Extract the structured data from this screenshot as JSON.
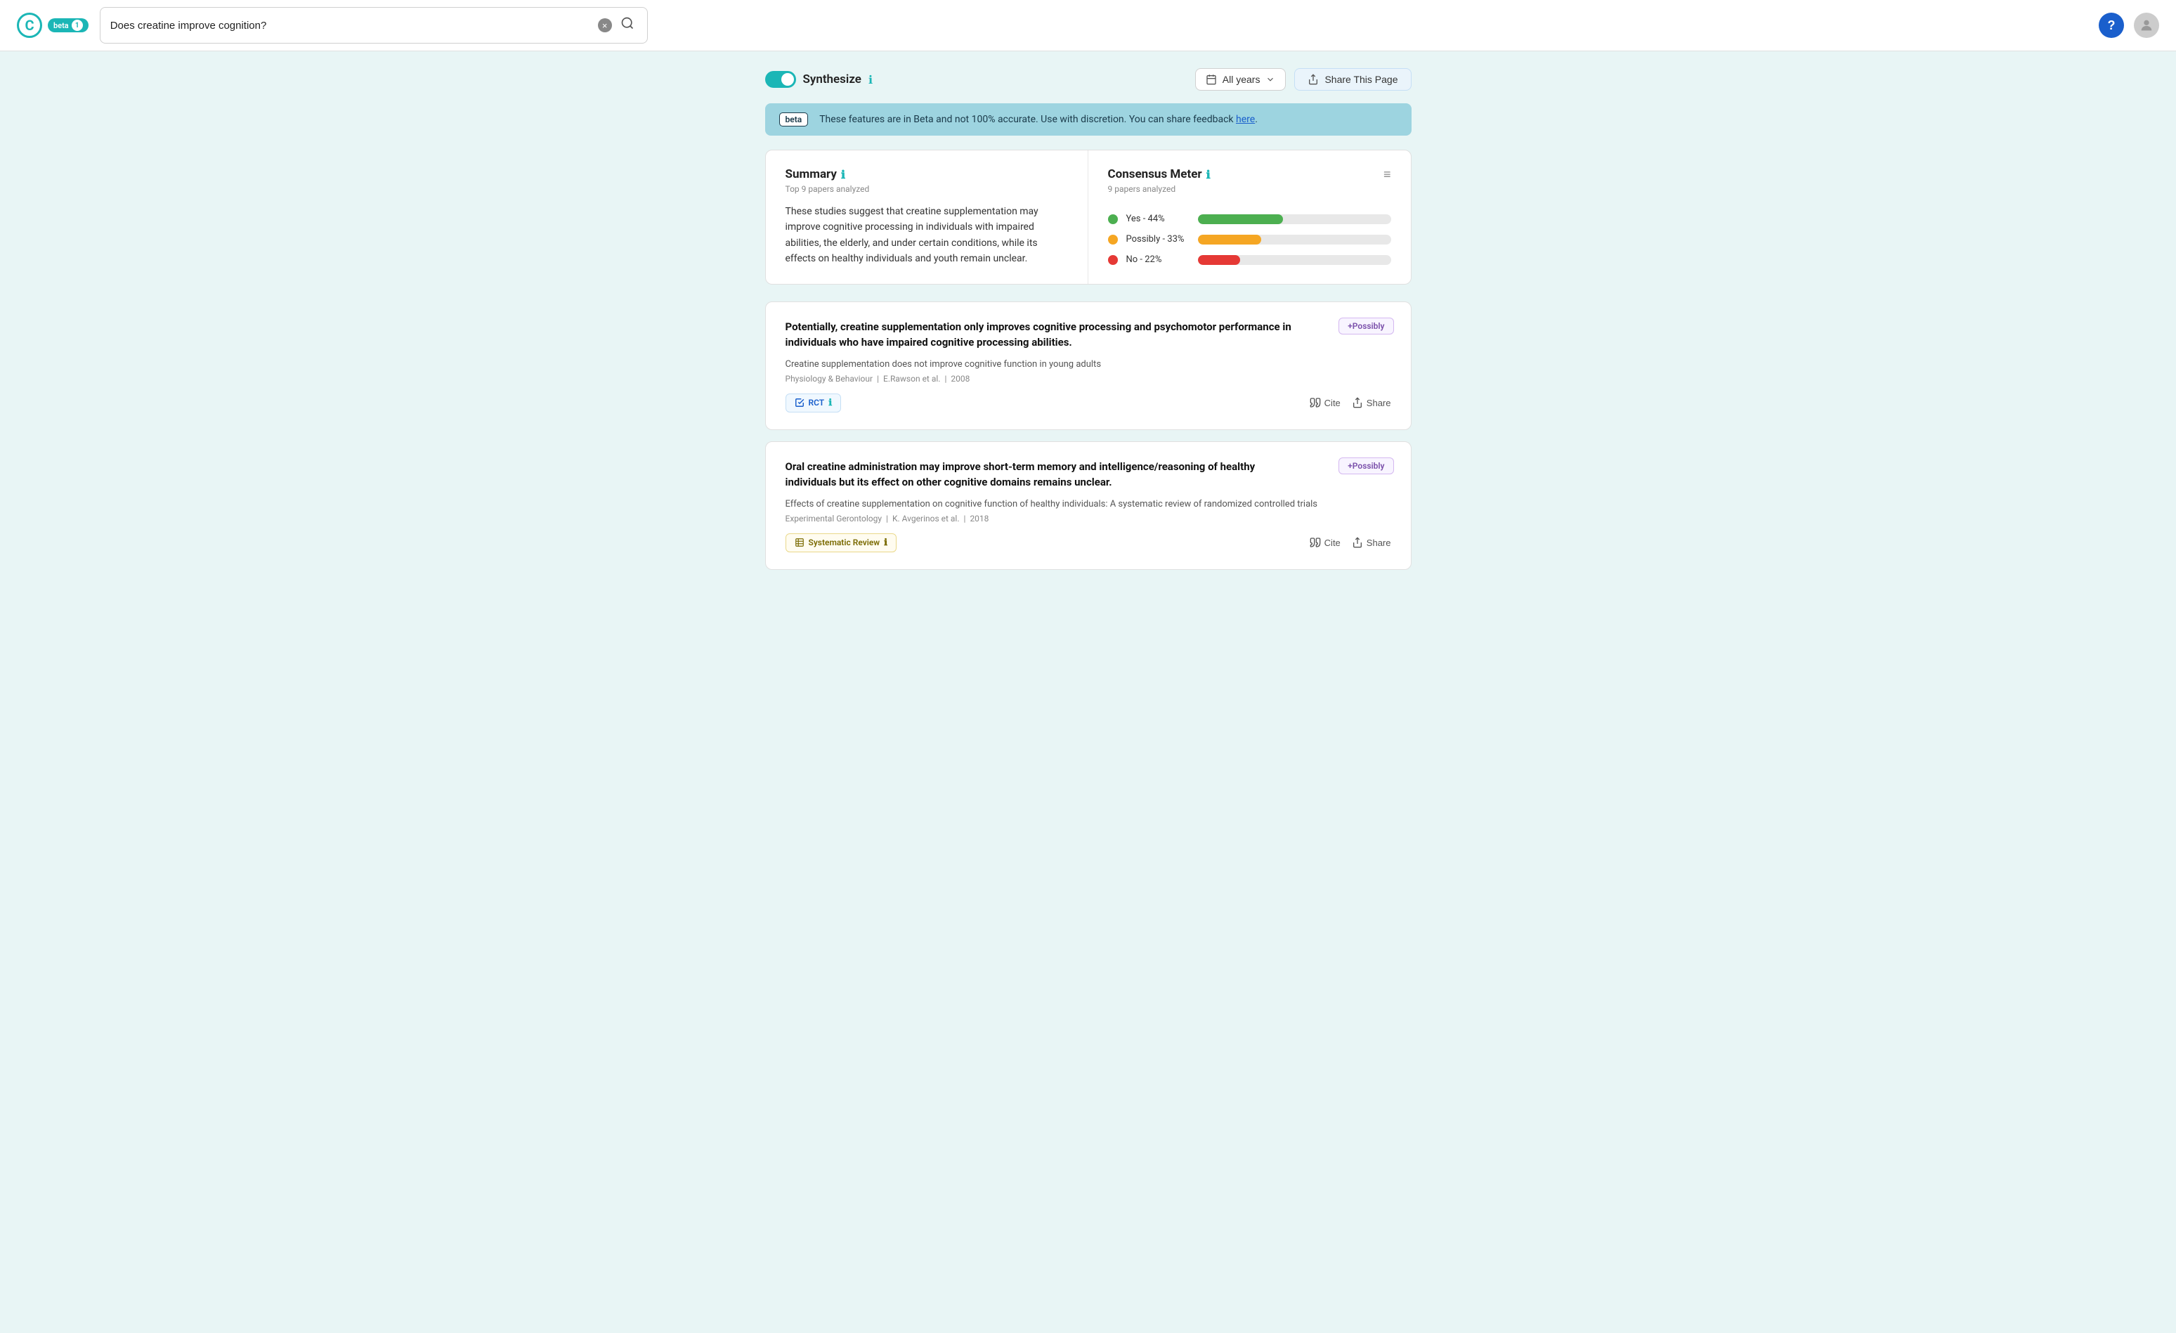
{
  "header": {
    "logo_letter": "C",
    "beta_label": "beta",
    "beta_count": "1",
    "search_value": "Does creatine improve cognition?",
    "help_label": "?",
    "search_clear_label": "×"
  },
  "controls": {
    "synthesize_label": "Synthesize",
    "year_filter_label": "All years",
    "share_page_label": "Share This Page"
  },
  "beta_banner": {
    "tag": "beta",
    "message": "These features are in Beta and not 100% accurate. Use with discretion. You can share feedback here."
  },
  "summary": {
    "title": "Summary",
    "info_icon": "ℹ",
    "subtitle": "Top 9 papers analyzed",
    "text": "These studies suggest that creatine supplementation may improve cognitive processing in individuals with impaired abilities, the elderly, and under certain conditions, while its effects on healthy individuals and youth remain unclear."
  },
  "consensus": {
    "title": "Consensus Meter",
    "info_icon": "ℹ",
    "subtitle": "9 papers analyzed",
    "filter_icon": "≡",
    "bars": [
      {
        "label": "Yes - 44%",
        "color": "#4caf50",
        "dot_color": "#4caf50",
        "percent": 44
      },
      {
        "label": "Possibly - 33%",
        "color": "#f5a623",
        "dot_color": "#f5a623",
        "percent": 33
      },
      {
        "label": "No - 22%",
        "color": "#e53935",
        "dot_color": "#e53935",
        "percent": 22
      }
    ]
  },
  "papers": [
    {
      "id": 1,
      "badge": "+Possibly",
      "title": "Potentially, creatine supplementation only improves cognitive processing and psychomotor performance in individuals who have impaired cognitive processing abilities.",
      "subtitle": "Creatine supplementation does not improve cognitive function  in young adults",
      "journal": "Physiology & Behaviour",
      "authors": "E.Rawson et al.",
      "year": "2008",
      "type": "RCT",
      "type_style": "rct",
      "cite_label": "Cite",
      "share_label": "Share"
    },
    {
      "id": 2,
      "badge": "+Possibly",
      "title": "Oral creatine administration may improve short-term memory and intelligence/reasoning of healthy individuals but its effect on other cognitive domains remains unclear.",
      "subtitle": "Effects of creatine supplementation on cognitive function of healthy individuals: A systematic review of randomized controlled trials",
      "journal": "Experimental Gerontology",
      "authors": "K. Avgerinos et al.",
      "year": "2018",
      "type": "Systematic Review",
      "type_style": "systematic",
      "cite_label": "Cite",
      "share_label": "Share"
    }
  ],
  "colors": {
    "teal": "#1bb6b6",
    "brand_blue": "#1a5fcc",
    "green": "#4caf50",
    "orange": "#f5a623",
    "red": "#e53935",
    "banner_bg": "#9dd4e0"
  }
}
